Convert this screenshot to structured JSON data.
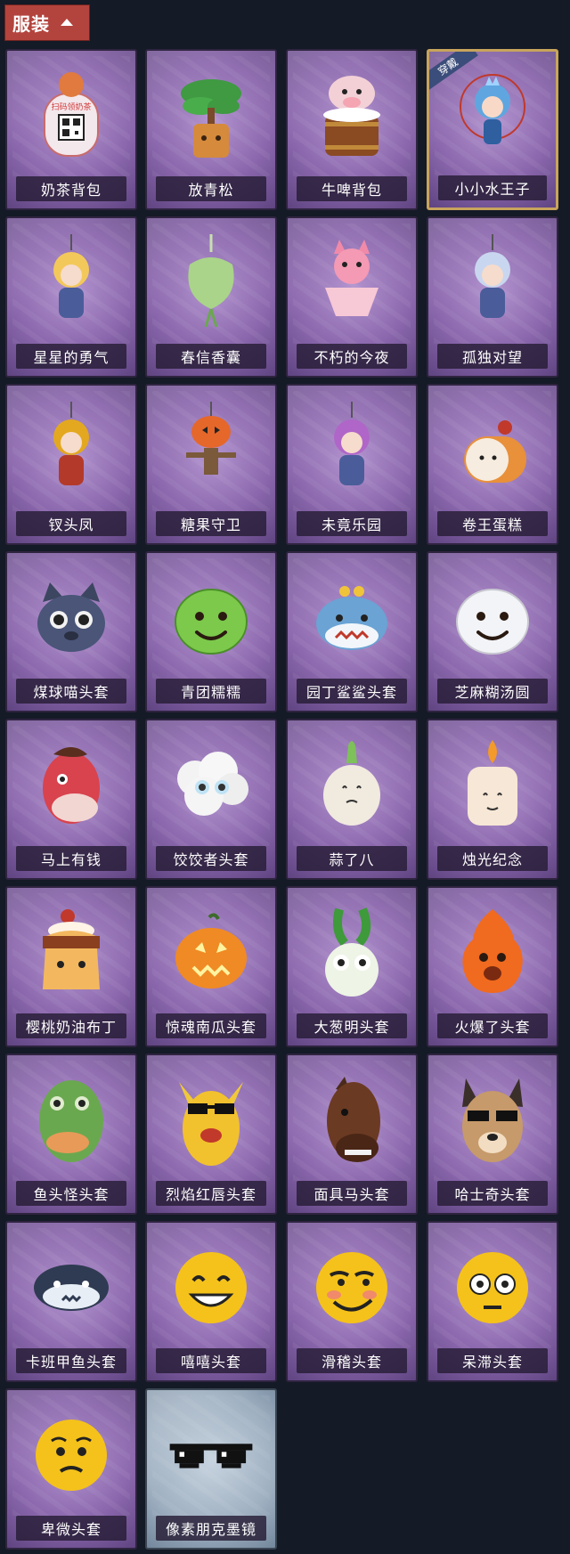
{
  "header": {
    "title": "服装"
  },
  "items": [
    {
      "label": "奶茶背包",
      "icon": "milk-tea-backpack-icon",
      "style": "purple",
      "scan_text": "扫码领奶茶"
    },
    {
      "label": "放青松",
      "icon": "bonsai-pine-icon",
      "style": "purple"
    },
    {
      "label": "牛啤背包",
      "icon": "cow-beer-barrel-icon",
      "style": "purple"
    },
    {
      "label": "小小水王子",
      "icon": "water-prince-icon",
      "style": "purple",
      "equipped": true,
      "badge": "穿戴"
    },
    {
      "label": "星星的勇气",
      "icon": "star-courage-charm-icon",
      "style": "purple"
    },
    {
      "label": "春信香囊",
      "icon": "sachet-icon",
      "style": "purple"
    },
    {
      "label": "不朽的今夜",
      "icon": "pink-fox-cup-icon",
      "style": "purple"
    },
    {
      "label": "孤独对望",
      "icon": "lonely-gaze-charm-icon",
      "style": "purple"
    },
    {
      "label": "钗头凤",
      "icon": "phoenix-hairpin-icon",
      "style": "purple"
    },
    {
      "label": "糖果守卫",
      "icon": "pumpkin-scarecrow-icon",
      "style": "purple"
    },
    {
      "label": "未竟乐园",
      "icon": "unfinished-paradise-icon",
      "style": "purple"
    },
    {
      "label": "卷王蛋糕",
      "icon": "roll-cake-icon",
      "style": "purple"
    },
    {
      "label": "煤球喵头套",
      "icon": "coal-cat-head-icon",
      "style": "purple"
    },
    {
      "label": "青团糯糯",
      "icon": "green-rice-ball-icon",
      "style": "purple"
    },
    {
      "label": "园丁鲨鲨头套",
      "icon": "gardener-shark-head-icon",
      "style": "purple"
    },
    {
      "label": "芝麻糊汤圆",
      "icon": "sesame-dumpling-icon",
      "style": "purple"
    },
    {
      "label": "马上有钱",
      "icon": "red-horse-head-icon",
      "style": "purple"
    },
    {
      "label": "饺饺者头套",
      "icon": "dumpling-cloud-head-icon",
      "style": "purple"
    },
    {
      "label": "蒜了八",
      "icon": "garlic-icon",
      "style": "purple"
    },
    {
      "label": "烛光纪念",
      "icon": "candle-icon",
      "style": "purple"
    },
    {
      "label": "樱桃奶油布丁",
      "icon": "cherry-pudding-icon",
      "style": "purple"
    },
    {
      "label": "惊魂南瓜头套",
      "icon": "pumpkin-head-icon",
      "style": "purple"
    },
    {
      "label": "大葱明头套",
      "icon": "scallion-head-icon",
      "style": "purple"
    },
    {
      "label": "火爆了头套",
      "icon": "fire-head-icon",
      "style": "purple"
    },
    {
      "label": "鱼头怪头套",
      "icon": "fish-head-icon",
      "style": "purple"
    },
    {
      "label": "烈焰红唇头套",
      "icon": "red-lips-head-icon",
      "style": "purple"
    },
    {
      "label": "面具马头套",
      "icon": "horse-mask-icon",
      "style": "purple"
    },
    {
      "label": "哈士奇头套",
      "icon": "husky-head-icon",
      "style": "purple"
    },
    {
      "label": "卡班甲鱼头套",
      "icon": "turtle-head-icon",
      "style": "purple"
    },
    {
      "label": "嘻嘻头套",
      "icon": "grin-emoji-head-icon",
      "style": "purple"
    },
    {
      "label": "滑稽头套",
      "icon": "funny-emoji-head-icon",
      "style": "purple"
    },
    {
      "label": "呆滞头套",
      "icon": "dazed-emoji-head-icon",
      "style": "purple"
    },
    {
      "label": "卑微头套",
      "icon": "humble-emoji-head-icon",
      "style": "purple"
    },
    {
      "label": "像素朋克墨镜",
      "icon": "pixel-sunglasses-icon",
      "style": "gray"
    }
  ]
}
